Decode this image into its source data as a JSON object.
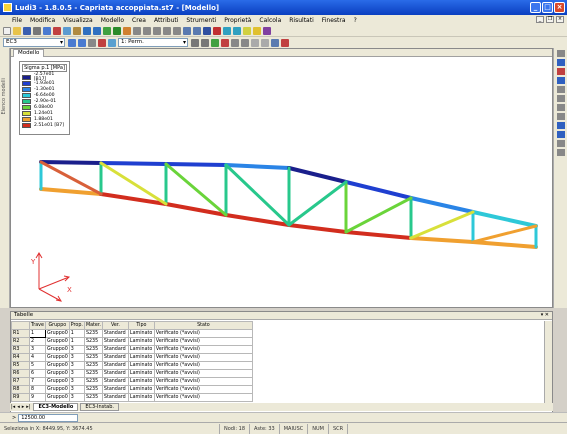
{
  "window": {
    "title": "Ludi3 - 1.8.0.5 - Capriata accoppiata.st7 - [Modello]"
  },
  "menu": [
    "File",
    "Modifica",
    "Visualizza",
    "Modello",
    "Crea",
    "Attributi",
    "Strumenti",
    "Proprietà",
    "Calcola",
    "Risultati",
    "Finestra",
    "?"
  ],
  "toolbar2": {
    "analysis_combo": "EC3",
    "load_combo": "1: Perm."
  },
  "viewport": {
    "tab_label": "Modello",
    "side_label": "Elenco modelli"
  },
  "legend": {
    "title": "Sigma p.1 [MPa]",
    "entries": [
      {
        "label": "-2.57e01 [B17]",
        "color": "#1a1f8c"
      },
      {
        "label": "-1.93e01",
        "color": "#1f3fd0"
      },
      {
        "label": "-1.30e01",
        "color": "#2a84e6"
      },
      {
        "label": "-6.64e00",
        "color": "#2ec8d8"
      },
      {
        "label": "-2.90e-01",
        "color": "#28c88c"
      },
      {
        "label": "6.08e00",
        "color": "#6ad43a"
      },
      {
        "label": "1.24e01",
        "color": "#d8e03a"
      },
      {
        "label": "1.88e01",
        "color": "#f0a030"
      },
      {
        "label": "2.51e01 [B7]",
        "color": "#d22d1e"
      }
    ]
  },
  "axes": {
    "y": "Y",
    "x": "X"
  },
  "tables": {
    "title": "Tabelle",
    "columns": [
      "Trave",
      "Gruppo",
      "Prop.",
      "Mater.",
      "Ver.",
      "Tipo",
      "Stato"
    ],
    "rows": [
      {
        "id": "R1",
        "cells": [
          "1",
          "Gruppo0",
          "1",
          "S235",
          "Standard",
          "Laminato",
          "Verificato (*avvisi)"
        ]
      },
      {
        "id": "R2",
        "cells": [
          "2",
          "Gruppo0",
          "1",
          "S235",
          "Standard",
          "Laminato",
          "Verificato (*avvisi)"
        ]
      },
      {
        "id": "R3",
        "cells": [
          "3",
          "Gruppo0",
          "3",
          "S235",
          "Standard",
          "Laminato",
          "Verificato (*avvisi)"
        ]
      },
      {
        "id": "R4",
        "cells": [
          "4",
          "Gruppo0",
          "3",
          "S235",
          "Standard",
          "Laminato",
          "Verificato (*avvisi)"
        ]
      },
      {
        "id": "R5",
        "cells": [
          "5",
          "Gruppo0",
          "3",
          "S235",
          "Standard",
          "Laminato",
          "Verificato (*avvisi)"
        ]
      },
      {
        "id": "R6",
        "cells": [
          "6",
          "Gruppo0",
          "3",
          "S235",
          "Standard",
          "Laminato",
          "Verificato (*avvisi)"
        ]
      },
      {
        "id": "R7",
        "cells": [
          "7",
          "Gruppo0",
          "3",
          "S235",
          "Standard",
          "Laminato",
          "Verificato (*avvisi)"
        ]
      },
      {
        "id": "R8",
        "cells": [
          "8",
          "Gruppo0",
          "3",
          "S235",
          "Standard",
          "Laminato",
          "Verificato (*avvisi)"
        ]
      },
      {
        "id": "R9",
        "cells": [
          "9",
          "Gruppo0",
          "3",
          "S235",
          "Standard",
          "Laminato",
          "Verificato (*avvisi)"
        ]
      }
    ]
  },
  "sheet_tabs": [
    "EC3-Modello",
    "EC3-Instab."
  ],
  "command": {
    "prompt": ">",
    "value": "12500.00"
  },
  "status": {
    "coords": "Seleziona in X: 8449.95, Y: 3674.45",
    "fields": [
      "Nodi: 18",
      "Aste: 33",
      "MAIUSC",
      "NUM",
      "SCR"
    ]
  }
}
